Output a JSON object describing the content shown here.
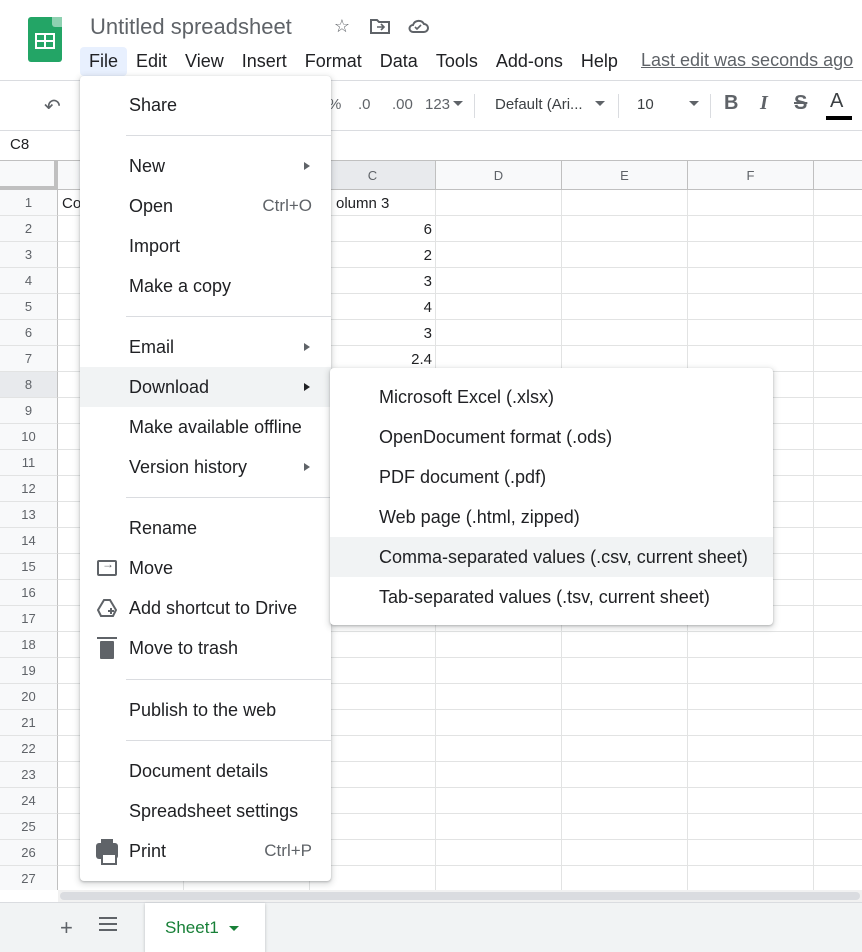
{
  "doc": {
    "title": "Untitled spreadsheet",
    "last_edit": "Last edit was seconds ago"
  },
  "title_icons": [
    "star-icon",
    "move-folder-icon",
    "cloud-status-icon"
  ],
  "menubar": [
    "File",
    "Edit",
    "View",
    "Insert",
    "Format",
    "Data",
    "Tools",
    "Add-ons",
    "Help"
  ],
  "toolbar": {
    "percent": "%",
    "dec_less": ".0",
    "dec_more": ".00",
    "number_format": "123",
    "font": "Default (Ari...",
    "font_size": "10",
    "bold": "B",
    "italic": "I",
    "strike": "S",
    "text_color": "A"
  },
  "namebox": "C8",
  "columns": [
    "",
    "",
    "C",
    "D",
    "E",
    "F"
  ],
  "rows": [
    "1",
    "2",
    "3",
    "4",
    "5",
    "6",
    "7",
    "8",
    "9",
    "10",
    "11",
    "12",
    "13",
    "14",
    "15",
    "16",
    "17",
    "18",
    "19",
    "20",
    "21",
    "22",
    "23",
    "24",
    "25",
    "26",
    "27"
  ],
  "cells": {
    "a1": "Co",
    "c1": "olumn 3",
    "c_values": [
      "6",
      "2",
      "3",
      "4",
      "3",
      "2.4"
    ]
  },
  "file_menu": {
    "share": "Share",
    "new": "New",
    "open": "Open",
    "open_shortcut": "Ctrl+O",
    "import": "Import",
    "make_copy": "Make a copy",
    "email": "Email",
    "download": "Download",
    "offline": "Make available offline",
    "version_history": "Version history",
    "rename": "Rename",
    "move": "Move",
    "add_shortcut": "Add shortcut to Drive",
    "trash": "Move to trash",
    "publish": "Publish to the web",
    "doc_details": "Document details",
    "settings": "Spreadsheet settings",
    "print": "Print",
    "print_shortcut": "Ctrl+P"
  },
  "download_menu": [
    "Microsoft Excel (.xlsx)",
    "OpenDocument format (.ods)",
    "PDF document (.pdf)",
    "Web page (.html, zipped)",
    "Comma-separated values (.csv, current sheet)",
    "Tab-separated values (.tsv, current sheet)"
  ],
  "sheet_tab": "Sheet1",
  "colors": {
    "brand": "#23a566",
    "sheet_tab_text": "#188038",
    "menu_hover": "#f1f3f4",
    "menubar_active": "#e8f0fe"
  }
}
